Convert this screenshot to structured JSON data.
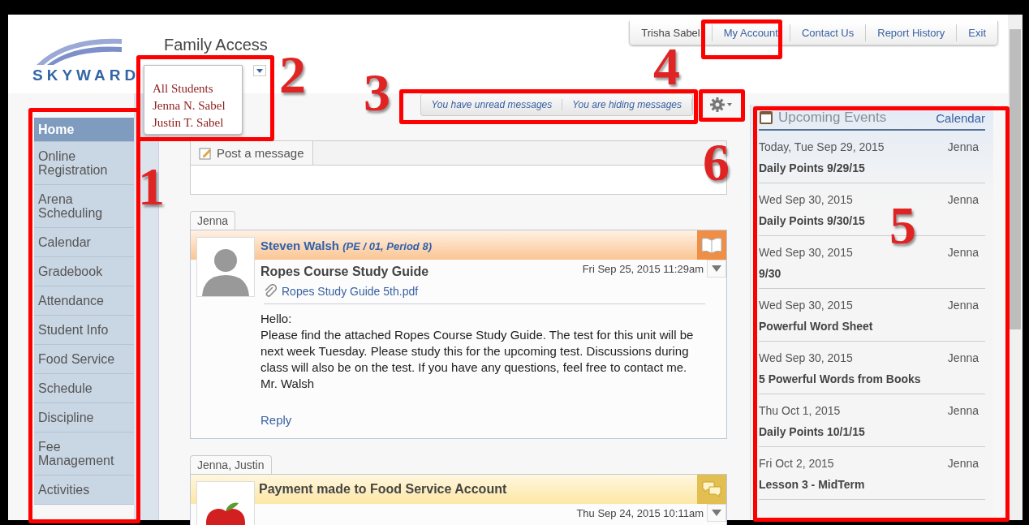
{
  "header": {
    "logo": "SKYWARD",
    "title": "Family Access"
  },
  "top_nav": [
    {
      "label": "Trisha Sabel",
      "kind": "user"
    },
    {
      "label": "My Account",
      "kind": "link"
    },
    {
      "label": "Contact Us",
      "kind": "link"
    },
    {
      "label": "Report History",
      "kind": "link"
    },
    {
      "label": "Exit",
      "kind": "link"
    }
  ],
  "student_menu": [
    "All Students",
    "Jenna N. Sabel",
    "Justin T. Sabel"
  ],
  "sidebar": {
    "items": [
      {
        "label": "Home",
        "selected": true
      },
      {
        "label": "Online Registration",
        "selected": false
      },
      {
        "label": "Arena Scheduling",
        "selected": false
      },
      {
        "label": "Calendar",
        "selected": false
      },
      {
        "label": "Gradebook",
        "selected": false
      },
      {
        "label": "Attendance",
        "selected": false
      },
      {
        "label": "Student Info",
        "selected": false
      },
      {
        "label": "Food Service",
        "selected": false
      },
      {
        "label": "Schedule",
        "selected": false
      },
      {
        "label": "Discipline",
        "selected": false
      },
      {
        "label": "Fee Management",
        "selected": false
      },
      {
        "label": "Activities",
        "selected": false
      }
    ]
  },
  "message_toolbar": [
    "You have unread messages",
    "You are hiding messages"
  ],
  "post_box": {
    "tab": "Post a message"
  },
  "messages": [
    {
      "students": "Jenna",
      "kind": "teacher",
      "sender": "Steven Walsh",
      "course": "(PE / 01, Period 8)",
      "subject": "Ropes Course Study Guide",
      "date": "Fri Sep 25, 2015 11:29am",
      "attachment": "Ropes Study Guide 5th.pdf",
      "body": [
        "Hello:",
        "Please find the attached Ropes Course Study Guide.  The test for this unit will be next week Tuesday.  Please study this for the upcoming test.  Discussions during class will also be on the test.  If you have any questions, feel free to contact me.",
        "Mr. Walsh"
      ],
      "reply": "Reply"
    },
    {
      "students": "Jenna, Justin",
      "kind": "food",
      "subject": "Payment made to Food Service Account",
      "date": "Thu Sep 24, 2015 10:11am"
    }
  ],
  "events": {
    "title": "Upcoming Events",
    "link": "Calendar",
    "items": [
      {
        "date": "Today, Tue Sep 29, 2015",
        "student": "Jenna",
        "title": "Daily Points 9/29/15"
      },
      {
        "date": "Wed Sep 30, 2015",
        "student": "Jenna",
        "title": "Daily Points 9/30/15"
      },
      {
        "date": "Wed Sep 30, 2015",
        "student": "Jenna",
        "title": "9/30"
      },
      {
        "date": "Wed Sep 30, 2015",
        "student": "Jenna",
        "title": "Powerful Word Sheet"
      },
      {
        "date": "Wed Sep 30, 2015",
        "student": "Jenna",
        "title": "5 Powerful Words from Books"
      },
      {
        "date": "Thu Oct 1, 2015",
        "student": "Jenna",
        "title": "Daily Points 10/1/15"
      },
      {
        "date": "Fri Oct 2, 2015",
        "student": "Jenna",
        "title": "Lesson 3 - MidTerm"
      }
    ]
  },
  "annotations": [
    "1",
    "2",
    "3",
    "4",
    "5",
    "6"
  ]
}
